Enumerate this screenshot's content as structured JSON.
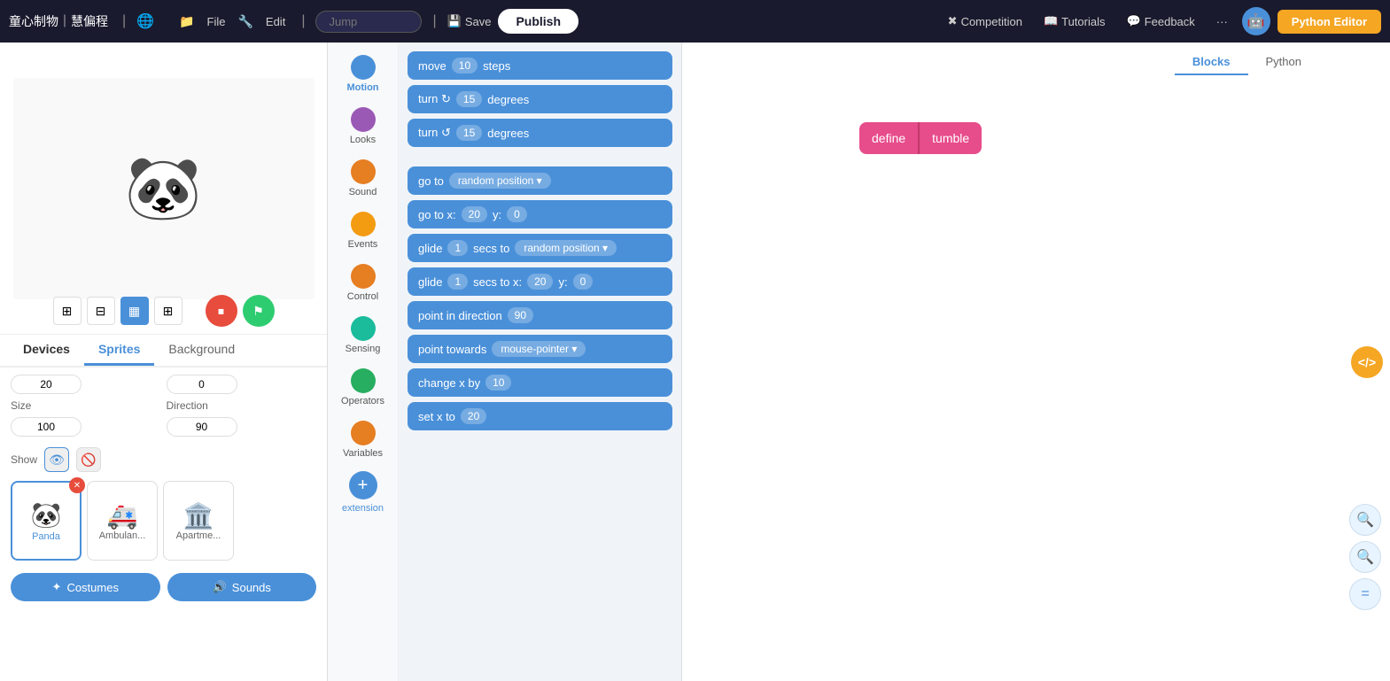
{
  "brand": {
    "logo_text": "童心制物｜慧偏程",
    "globe_icon": "🌐"
  },
  "topnav": {
    "file_label": "File",
    "edit_label": "Edit",
    "jump_placeholder": "Jump",
    "save_label": "Save",
    "publish_label": "Publish",
    "competition_label": "Competition",
    "tutorials_label": "Tutorials",
    "feedback_label": "Feedback",
    "more_label": "···",
    "python_editor_label": "Python Editor"
  },
  "stage": {
    "panda_emoji": "🐼"
  },
  "tabs": {
    "devices_label": "Devices",
    "sprites_label": "Sprites",
    "background_label": "Background"
  },
  "sprite_props": {
    "x_value": "20",
    "y_value": "0",
    "size_label": "Size",
    "size_value": "100",
    "direction_label": "Direction",
    "direction_value": "90",
    "show_label": "Show"
  },
  "sprites": [
    {
      "name": "Panda",
      "emoji": "🐼",
      "selected": true
    },
    {
      "name": "Ambulan...",
      "emoji": "🚑",
      "selected": false
    },
    {
      "name": "Apartme...",
      "emoji": "🏛️",
      "selected": false
    }
  ],
  "bottom_btns": {
    "costumes_label": "Costumes",
    "sounds_label": "Sounds",
    "star_icon": "✦",
    "speaker_icon": "🔊"
  },
  "categories": [
    {
      "id": "motion",
      "label": "Motion",
      "color": "#4a90d9",
      "active": true
    },
    {
      "id": "looks",
      "label": "Looks",
      "color": "#9b59b6"
    },
    {
      "id": "sound",
      "label": "Sound",
      "color": "#e67e22"
    },
    {
      "id": "events",
      "label": "Events",
      "color": "#f39c12"
    },
    {
      "id": "control",
      "label": "Control",
      "color": "#e67e22"
    },
    {
      "id": "sensing",
      "label": "Sensing",
      "color": "#1abc9c"
    },
    {
      "id": "operators",
      "label": "Operators",
      "color": "#27ae60"
    },
    {
      "id": "variables",
      "label": "Variables",
      "color": "#e67e22"
    }
  ],
  "blocks": [
    {
      "id": "move",
      "text": "move",
      "value": "10",
      "suffix": "steps"
    },
    {
      "id": "turn-cw",
      "text": "turn ↻",
      "value": "15",
      "suffix": "degrees"
    },
    {
      "id": "turn-ccw",
      "text": "turn ↺",
      "value": "15",
      "suffix": "degrees"
    },
    {
      "id": "goto-random",
      "text": "go to",
      "dropdown": "random position ▾"
    },
    {
      "id": "goto-xy",
      "text": "go to x:",
      "val1": "20",
      "text2": "y:",
      "val2": "0"
    },
    {
      "id": "glide-random",
      "text": "glide",
      "value": "1",
      "mid": "secs to",
      "dropdown": "random position ▾"
    },
    {
      "id": "glide-xy",
      "text": "glide",
      "value": "1",
      "mid": "secs to x:",
      "val1": "20",
      "text2": "y:",
      "val2": "0"
    },
    {
      "id": "point-dir",
      "text": "point in direction",
      "value": "90"
    },
    {
      "id": "point-towards",
      "text": "point towards",
      "dropdown": "mouse-pointer ▾"
    },
    {
      "id": "change-x",
      "text": "change x by",
      "value": "10"
    },
    {
      "id": "set-x",
      "text": "set x to",
      "value": "20"
    }
  ],
  "workspace": {
    "blocks_tab": "Blocks",
    "python_tab": "Python",
    "define_label": "define",
    "tumble_label": "tumble",
    "code_icon": "</>",
    "zoom_in": "+",
    "zoom_out": "−",
    "zoom_reset": "="
  }
}
